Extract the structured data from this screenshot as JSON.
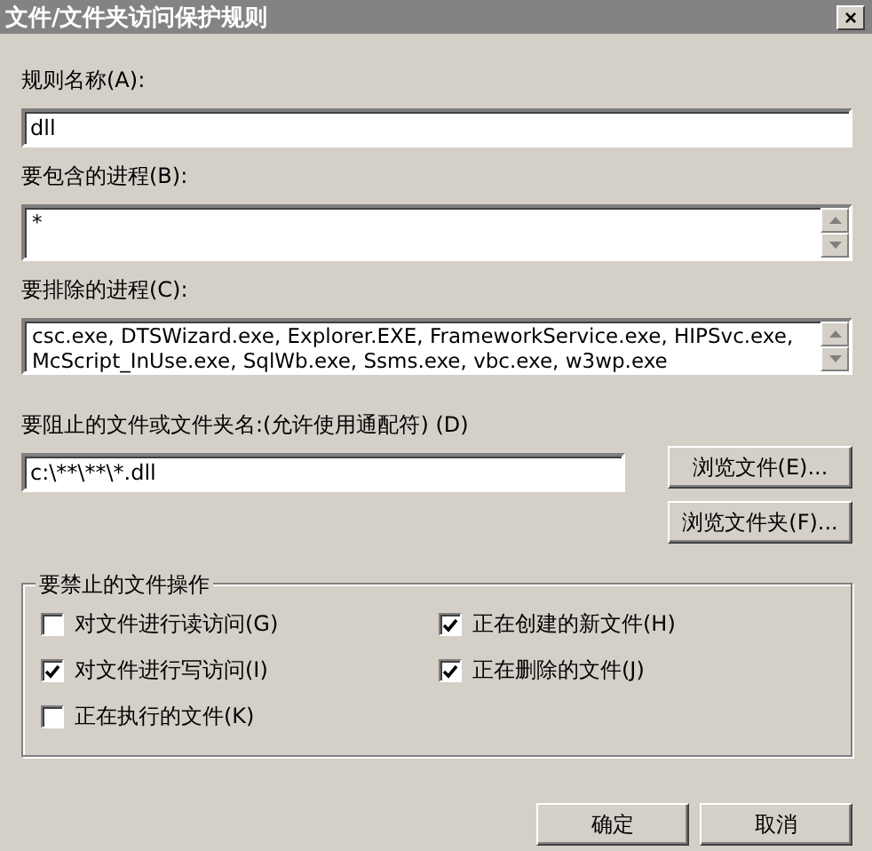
{
  "window": {
    "title": "文件/文件夹访问保护规则",
    "close": "×"
  },
  "rule_name": {
    "label": "规则名称(A):",
    "value": "dll"
  },
  "include_processes": {
    "label": "要包含的进程(B):",
    "value": "*"
  },
  "exclude_processes": {
    "label": "要排除的进程(C):",
    "value": "csc.exe, DTSWizard.exe, Explorer.EXE, FrameworkService.exe, HIPSvc.exe, McScript_InUse.exe, SqlWb.exe, Ssms.exe, vbc.exe, w3wp.exe"
  },
  "blocked_path": {
    "label": "要阻止的文件或文件夹名:(允许使用通配符) (D)",
    "value": "c:\\**\\**\\*.dll",
    "buttons": [
      "浏览文件(E)...",
      "浏览文件夹(F)..."
    ]
  },
  "operations": {
    "title": "要禁止的文件操作",
    "items": [
      {
        "label": "对文件进行读访问(G)",
        "checked": false
      },
      {
        "label": "正在创建的新文件(H)",
        "checked": true
      },
      {
        "label": "对文件进行写访问(I)",
        "checked": true
      },
      {
        "label": "正在删除的文件(J)",
        "checked": true
      },
      {
        "label": "正在执行的文件(K)",
        "checked": false
      }
    ]
  },
  "buttons": [
    "确定",
    "取消"
  ]
}
